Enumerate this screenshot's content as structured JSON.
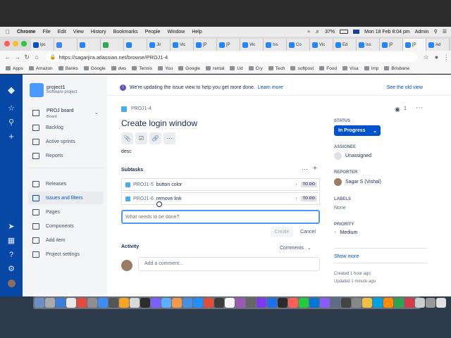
{
  "menubar": {
    "app": "Chrome",
    "items": [
      "File",
      "Edit",
      "View",
      "History",
      "Bookmarks",
      "People",
      "Window",
      "Help"
    ],
    "battery": "37%",
    "datetime": "Mon 18 Feb  8:04 pm",
    "user": "Admin"
  },
  "tabs": [
    {
      "label": "lpc",
      "color": "#0052cc"
    },
    {
      "label": "",
      "color": "#4285f4"
    },
    {
      "label": "",
      "color": "#2684ff"
    },
    {
      "label": "",
      "color": "#34a853"
    },
    {
      "label": "",
      "color": "#2684ff"
    },
    {
      "label": "Jir",
      "color": "#2684ff"
    },
    {
      "label": "Vic",
      "color": "#2684ff"
    },
    {
      "label": "[P",
      "color": "#2684ff"
    },
    {
      "label": "[P",
      "color": "#2684ff"
    },
    {
      "label": "Vic",
      "color": "#2684ff"
    },
    {
      "label": "Iss",
      "color": "#2684ff"
    },
    {
      "label": "Co",
      "color": "#2684ff"
    },
    {
      "label": "Vic",
      "color": "#2684ff"
    },
    {
      "label": "Ed",
      "color": "#2684ff"
    },
    {
      "label": "Iss",
      "color": "#2684ff"
    },
    {
      "label": "[P",
      "color": "#2684ff"
    },
    {
      "label": "[P",
      "color": "#2684ff"
    },
    {
      "label": "Ad",
      "color": "#2684ff"
    }
  ],
  "address": {
    "url": "https://sagarjira.atlassian.net/browse/PROJ1-4"
  },
  "bookmarks": [
    "Apps",
    "Amazon",
    "Banks",
    "Google",
    "dws",
    "Tennis",
    "You",
    "Google",
    "rental",
    "Ud",
    "Cry",
    "Tech",
    "softpost",
    "Food",
    "Visa",
    "Imp",
    "Brisbane"
  ],
  "project": {
    "name": "project1",
    "type": "Software project",
    "board_name": "PROJ board",
    "board_sub": "Board",
    "nav": [
      "Backlog",
      "Active sprints",
      "Reports"
    ],
    "nav2": [
      "Releases",
      "Issues and filters",
      "Pages",
      "Components",
      "Add item",
      "Project settings"
    ]
  },
  "banner": {
    "text": "We're updating the issue view to help you get more done.",
    "link": "Learn more",
    "old_view": "See the old view"
  },
  "issue": {
    "key": "PROJ1-4",
    "title": "Create login window",
    "description": "desc",
    "watchers": "1",
    "subtasks_label": "Subtasks",
    "subtasks": [
      {
        "key": "PROJ1-5",
        "summary": "button color",
        "status": "TO DO"
      },
      {
        "key": "PROJ1-6",
        "summary": "remove link",
        "status": "TO DO"
      }
    ],
    "new_subtask_placeholder": "What needs to be done?",
    "create_label": "Create",
    "cancel_label": "Cancel",
    "activity_label": "Activity",
    "comments_label": "Comments",
    "comment_placeholder": "Add a comment..."
  },
  "details": {
    "status_label": "STATUS",
    "status": "In Progress",
    "assignee_label": "ASSIGNEE",
    "assignee": "Unassigned",
    "reporter_label": "REPORTER",
    "reporter": "Sagar S (Vishal)",
    "labels_label": "LABELS",
    "labels": "None",
    "priority_label": "PRIORITY",
    "priority": "Medium",
    "show_more": "Show more",
    "created": "Created 1 hour ago",
    "updated": "Updated 1 minute ago"
  },
  "dock_colors": [
    "#6d8fc7",
    "#a9a9a9",
    "#3b7dd8",
    "#e8e8e8",
    "#e14b3b",
    "#8e8e93",
    "#3d8bf5",
    "#555",
    "#f5a623",
    "#d9d9d9",
    "#2d2d2d",
    "#7b61ff",
    "#5ab0ff",
    "#f2994a",
    "#4a90e2",
    "#1e90ff",
    "#e04e39",
    "#3c3c3c",
    "#f5f5f5",
    "#9b59b6",
    "#666",
    "#7c3aed",
    "#1f6feb",
    "#2b2b2b",
    "#ff5f57",
    "#27c93f",
    "#0078d4",
    "#8b5cf6",
    "#5e6c84",
    "#444",
    "#888",
    "#f0c040",
    "#00a3e0",
    "#ff8c00",
    "#2da44e",
    "#d73a49",
    "#ccc",
    "#999",
    "#e0e0e0"
  ],
  "colors": {
    "global_nav": "#0747a6",
    "accent": "#0052cc"
  }
}
